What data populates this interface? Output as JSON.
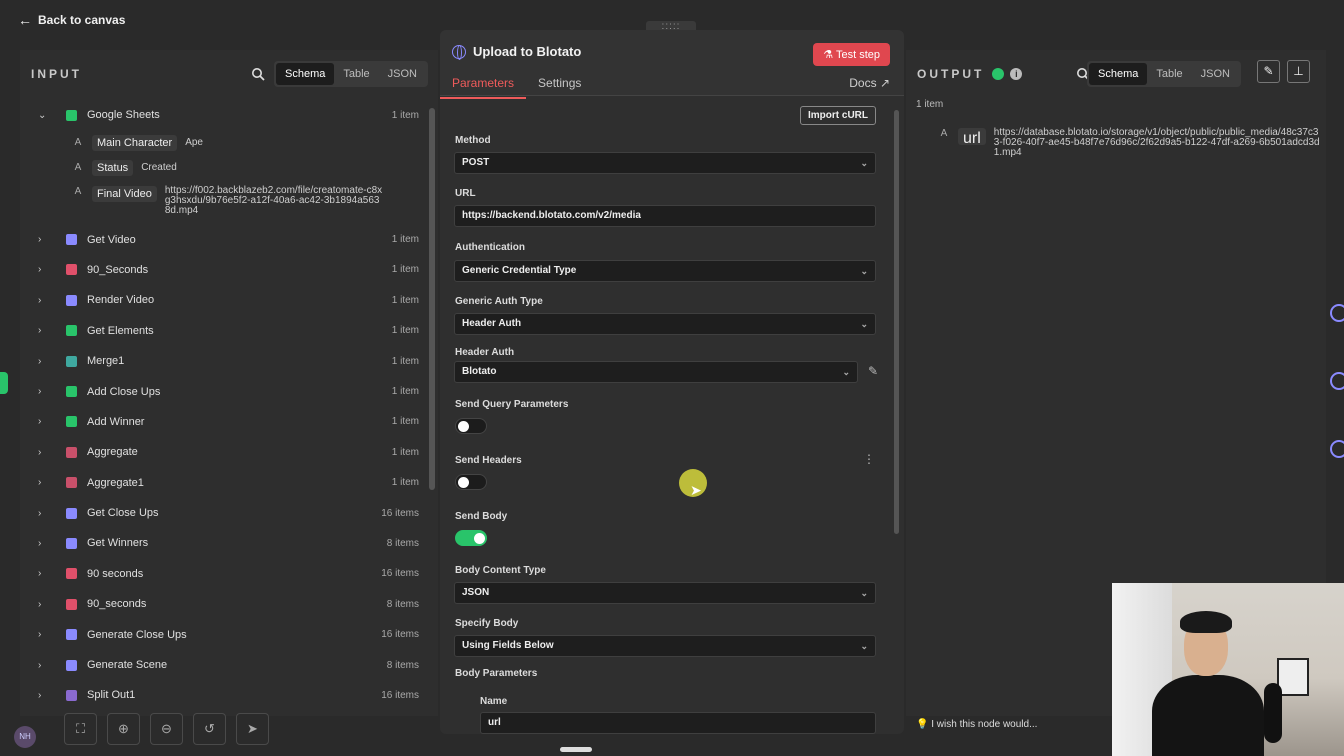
{
  "top": {
    "back_label": "Back to canvas",
    "drag_grip": ":::::"
  },
  "input": {
    "title": "INPUT",
    "view_tabs": [
      "Schema",
      "Table",
      "JSON"
    ],
    "root_node": {
      "name": "Google Sheets",
      "count": "1 item",
      "fields": [
        {
          "type": "A",
          "name": "Main Character",
          "value": "Ape"
        },
        {
          "type": "A",
          "name": "Status",
          "value": "Created"
        },
        {
          "type": "A",
          "name": "Final Video",
          "value": "https://f002.backblazeb2.com/file/creatomate-c8xg3hsxdu/9b76e5f2-a12f-40a6-ac42-3b1894a5638d.mp4"
        }
      ]
    },
    "nodes": [
      {
        "name": "Get Video",
        "count": "1 item",
        "color": "#8a8aff"
      },
      {
        "name": "90_Seconds",
        "count": "1 item",
        "color": "#e0506a"
      },
      {
        "name": "Render Video",
        "count": "1 item",
        "color": "#8a8aff"
      },
      {
        "name": "Get Elements",
        "count": "1 item",
        "color": "#29c46a"
      },
      {
        "name": "Merge1",
        "count": "1 item",
        "color": "#3fa9a0"
      },
      {
        "name": "Add Close Ups",
        "count": "1 item",
        "color": "#29c46a"
      },
      {
        "name": "Add Winner",
        "count": "1 item",
        "color": "#29c46a"
      },
      {
        "name": "Aggregate",
        "count": "1 item",
        "color": "#c9506a"
      },
      {
        "name": "Aggregate1",
        "count": "1 item",
        "color": "#c9506a"
      },
      {
        "name": "Get Close Ups",
        "count": "16 items",
        "color": "#8a8aff"
      },
      {
        "name": "Get Winners",
        "count": "8 items",
        "color": "#8a8aff"
      },
      {
        "name": "90 seconds",
        "count": "16 items",
        "color": "#e0506a"
      },
      {
        "name": "90_seconds",
        "count": "8 items",
        "color": "#e0506a"
      },
      {
        "name": "Generate Close Ups",
        "count": "16 items",
        "color": "#8a8aff"
      },
      {
        "name": "Generate Scene",
        "count": "8 items",
        "color": "#8a8aff"
      },
      {
        "name": "Split Out1",
        "count": "16 items",
        "color": "#8a6ad0"
      }
    ]
  },
  "node": {
    "title": "Upload to Blotato",
    "test_button": "Test step",
    "tabs": [
      "Parameters",
      "Settings"
    ],
    "docs": "Docs",
    "import_curl": "Import cURL",
    "method_label": "Method",
    "method": "POST",
    "url_label": "URL",
    "url": "https://backend.blotato.com/v2/media",
    "auth_label": "Authentication",
    "auth": "Generic Credential Type",
    "generic_auth_label": "Generic Auth Type",
    "generic_auth": "Header Auth",
    "header_auth_label": "Header Auth",
    "header_auth": "Blotato",
    "send_query_label": "Send Query Parameters",
    "send_query": false,
    "send_headers_label": "Send Headers",
    "send_headers": false,
    "send_body_label": "Send Body",
    "send_body": true,
    "body_content_type_label": "Body Content Type",
    "body_content_type": "JSON",
    "specify_body_label": "Specify Body",
    "specify_body": "Using Fields Below",
    "body_params_label": "Body Parameters",
    "param_name_label": "Name",
    "param_name": "url"
  },
  "output": {
    "title": "OUTPUT",
    "view_tabs": [
      "Schema",
      "Table",
      "JSON"
    ],
    "count": "1 item",
    "field_type": "A",
    "field_name": "url",
    "field_value": "https://database.blotato.io/storage/v1/object/public/public_media/48c37c33-f026-40f7-ae45-b48f7e76d96c/2f62d9a5-b122-47df-a269-6b501adcd3d1.mp4",
    "feedback": "I wish this node would..."
  },
  "footer": {
    "avatar_initials": "NH"
  }
}
